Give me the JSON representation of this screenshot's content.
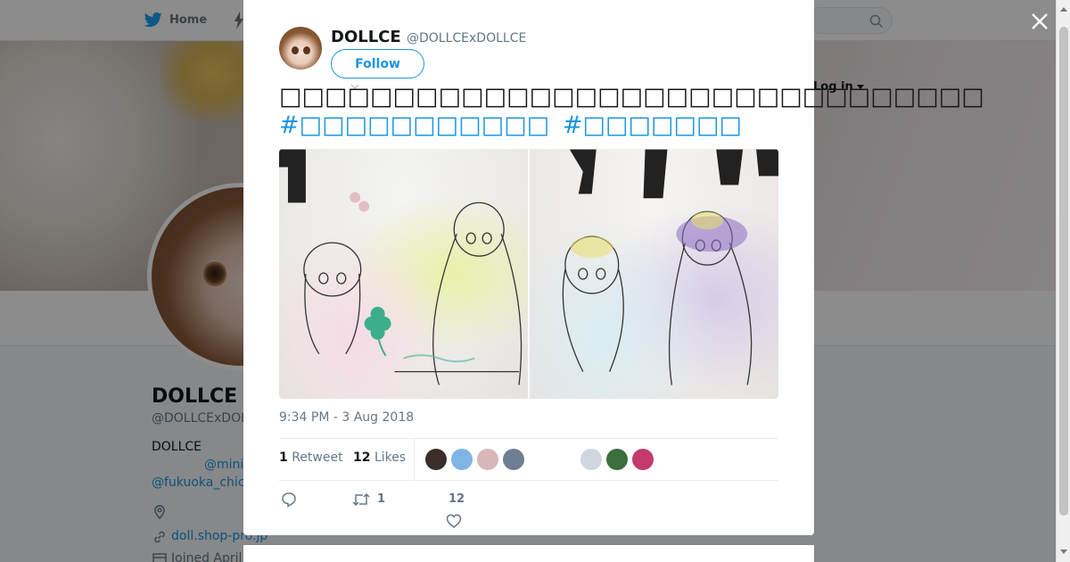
{
  "nav": {
    "home_label": "Home",
    "login_label": "Log in"
  },
  "profile": {
    "name": "DOLLCE",
    "handle": "@DOLLCExDOL",
    "bio_line1": "DOLLCE",
    "bio_line2": "@mini",
    "bio_line3": "@fukuoka_chic",
    "website": "doll.shop-pro.jp",
    "joined": "Joined April"
  },
  "tweet": {
    "author_name": "DOLLCE",
    "author_handle": "@DOLLCExDOLLCE",
    "follow_label": "Follow",
    "text": "□□□□□□□□□□□□□□□□□□□□□□□□□□□□□□□",
    "hashtags": [
      "#□□□□□□□□□□□",
      "#□□□□□□□"
    ],
    "timestamp": "9:34 PM - 3 Aug 2018",
    "retweet_count": "1",
    "retweet_label": "Retweet",
    "like_count": "12",
    "like_label": "Likes",
    "action_retweet_count": "1",
    "action_like_count": "12"
  },
  "likers": [
    {
      "name": "liker-1",
      "color": "#3a2e2a"
    },
    {
      "name": "liker-2",
      "color": "#7fb4e6"
    },
    {
      "name": "liker-3",
      "color": "#d9b6b8"
    },
    {
      "name": "liker-4",
      "color": "#6f7f92"
    },
    {
      "name": "liker-5",
      "color": "#ffffff"
    },
    {
      "name": "liker-6",
      "color": "#ffffff"
    },
    {
      "name": "liker-7",
      "color": "#cfd6e0"
    },
    {
      "name": "liker-8",
      "color": "#3b6e3a"
    },
    {
      "name": "liker-9",
      "color": "#c23a6a"
    }
  ],
  "colors": {
    "accent": "#1b95e0",
    "text_primary": "#14171a",
    "text_secondary": "#657786"
  },
  "icons": [
    "twitter-bird-icon",
    "moments-icon",
    "search-icon",
    "close-icon",
    "location-icon",
    "link-icon",
    "calendar-icon",
    "reply-icon",
    "retweet-icon",
    "heart-icon",
    "caret-down-icon"
  ]
}
